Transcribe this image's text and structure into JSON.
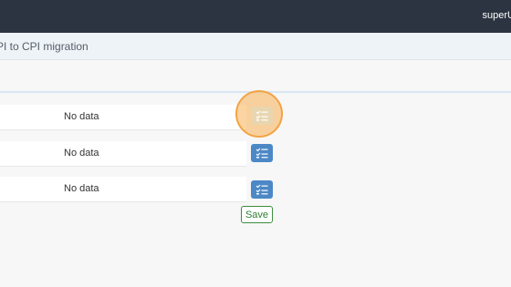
{
  "header": {
    "user": "superU"
  },
  "page": {
    "title": "PI to CPI migration"
  },
  "rows": [
    {
      "value": "No data"
    },
    {
      "value": "No data"
    },
    {
      "value": "No data"
    }
  ],
  "icons": {
    "row_action": "checklist-icon"
  },
  "actions": {
    "save_label": "Save"
  },
  "colors": {
    "topbar": "#2b3440",
    "accent": "#4c88c6",
    "highlight": "#f2a445",
    "save_border": "#3d8b3d"
  }
}
